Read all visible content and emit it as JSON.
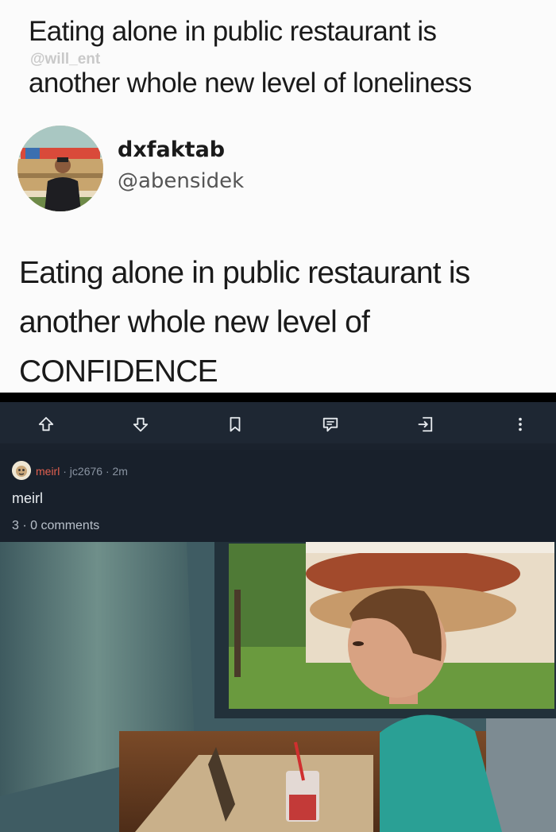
{
  "tweet": {
    "quoted_text_line1": "Eating alone in public restaurant is",
    "quoted_text_line2": "another whole new level of loneliness",
    "watermark": "@will_ent",
    "display_name": "dxfaktab",
    "handle": "@abensidek",
    "body_line1": "Eating alone in public restaurant is",
    "body_line2": "another whole new level of",
    "body_line3": "CONFIDENCE"
  },
  "actions": {
    "icons": [
      "upvote-icon",
      "downvote-icon",
      "bookmark-icon",
      "comment-icon",
      "share-icon",
      "more-icon"
    ]
  },
  "post": {
    "subreddit": "meirl",
    "separator": " · ",
    "author": "jc2676",
    "age": "2m",
    "title": "meirl",
    "score": "3",
    "comments": "0 comments"
  },
  "colors": {
    "app_bg": "#18202b",
    "toolbar_bg": "#1e2733",
    "subreddit_accent": "#e2604f",
    "meta_text": "#8a94a2"
  }
}
